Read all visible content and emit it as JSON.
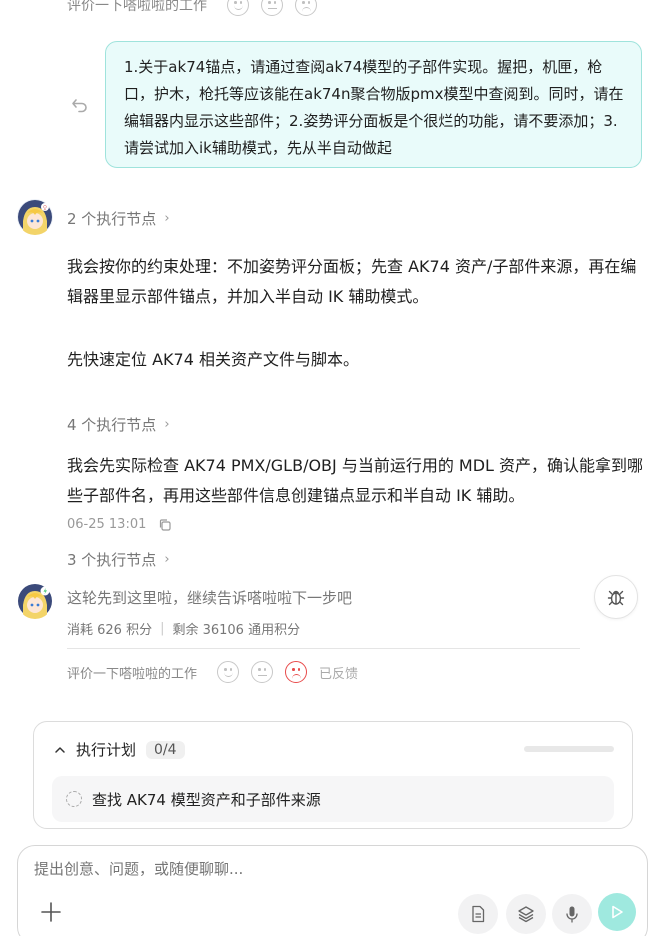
{
  "top_rating": {
    "label": "评价一下嗒啦啦的工作"
  },
  "user_message": {
    "text": "1.关于ak74锚点，请通过查阅ak74模型的子部件实现。握把，机匣，枪口，护木，枪托等应该能在ak74n聚合物版pmx模型中查阅到。同时，请在编辑器内显示这些部件；2.姿势评分面板是个很烂的功能，请不要添加；3.请尝试加入ik辅助模式，先从半自动做起"
  },
  "assistant": {
    "exec_nodes_1": "2 个执行节点",
    "para_1": "我会按你的约束处理：不加姿势评分面板；先查 AK74 资产/子部件来源，再在编辑器里显示部件锚点，并加入半自动 IK 辅助模式。",
    "para_2": "先快速定位 AK74 相关资产文件与脚本。",
    "exec_nodes_2": "4 个执行节点",
    "para_3": "我会先实际检查 AK74 PMX/GLB/OBJ 与当前运行用的 MDL 资产，确认能拿到哪些子部件名，再用这些部件信息创建锚点显示和半自动 IK 辅助。",
    "timestamp": "06-25 13:01",
    "exec_nodes_3": "3 个执行节点",
    "status_text": "这轮先到这里啦，继续告诉嗒啦啦下一步吧",
    "usage": "消耗 626 积分",
    "remaining": "剩余 36106 通用积分",
    "rating_label": "评价一下嗒啦啦的工作",
    "feedback_done": "已反馈"
  },
  "plan": {
    "title": "执行计划",
    "count": "0/4",
    "progress": 0,
    "item": "查找 AK74 模型资产和子部件来源"
  },
  "composer": {
    "placeholder": "提出创意、问题，或随便聊聊..."
  },
  "colors": {
    "accent": "#59c5b9",
    "bubble_bg": "#e9fbfa",
    "bubble_border": "#9fe3dc",
    "feedback_red": "#e84a4a"
  },
  "icons": [
    "undo-icon",
    "chevron-right-icon",
    "copy-icon",
    "bug-icon",
    "happy-face-icon",
    "neutral-face-icon",
    "sad-face-icon",
    "chevron-up-icon",
    "spinner-icon",
    "plus-icon",
    "file-icon",
    "layers-icon",
    "mic-icon",
    "send-icon"
  ]
}
